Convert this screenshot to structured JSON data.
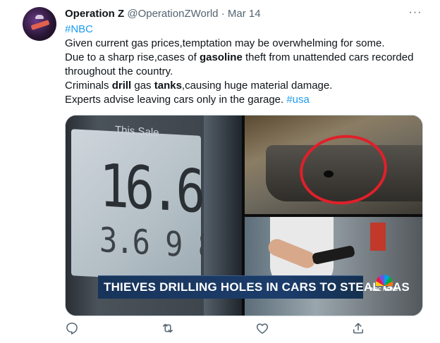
{
  "tweet": {
    "author_name": "Operation Z",
    "handle": "@OperationZWorld",
    "separator": "·",
    "date": "Mar 14",
    "more_label": "···",
    "lines": [
      {
        "parts": [
          {
            "text": "#NBC",
            "style": "link"
          }
        ]
      },
      {
        "parts": [
          {
            "text": "Given current gas prices,temptation may be overwhelming for some.",
            "style": "normal"
          }
        ]
      },
      {
        "parts": [
          {
            "text": "Due to a sharp rise,cases of ",
            "style": "normal"
          },
          {
            "text": "gasoline",
            "style": "bold"
          },
          {
            "text": " theft from unattended cars recorded",
            "style": "normal"
          }
        ]
      },
      {
        "parts": [
          {
            "text": "throughout the country.",
            "style": "normal"
          }
        ]
      },
      {
        "parts": [
          {
            "text": "Criminals ",
            "style": "normal"
          },
          {
            "text": "drill",
            "style": "bold"
          },
          {
            "text": " gas ",
            "style": "normal"
          },
          {
            "text": "tanks",
            "style": "bold"
          },
          {
            "text": ",causing huge material damage.",
            "style": "normal"
          }
        ]
      },
      {
        "parts": [
          {
            "text": "Experts advise leaving cars only in the garage. ",
            "style": "normal"
          },
          {
            "text": "#usa",
            "style": "link"
          }
        ]
      }
    ]
  },
  "media": {
    "pump_header": "This Sale",
    "pump_amount": "16.69",
    "pump_price": "3.6 9 8",
    "banner_text": "THIEVES DRILLING HOLES IN CARS TO STEAL GAS",
    "logo_text": "NBC NEWS"
  },
  "actions": [
    {
      "name": "reply-icon",
      "icon": "speech-bubble"
    },
    {
      "name": "retweet-icon",
      "icon": "retweet-arrows"
    },
    {
      "name": "like-icon",
      "icon": "heart"
    },
    {
      "name": "share-icon",
      "icon": "upload-arrow"
    }
  ],
  "colors": {
    "link": "#1d9bf0",
    "secondary": "#536471",
    "text": "#0f1419",
    "circle": "#e0202a",
    "banner": "#1c3d6b"
  }
}
